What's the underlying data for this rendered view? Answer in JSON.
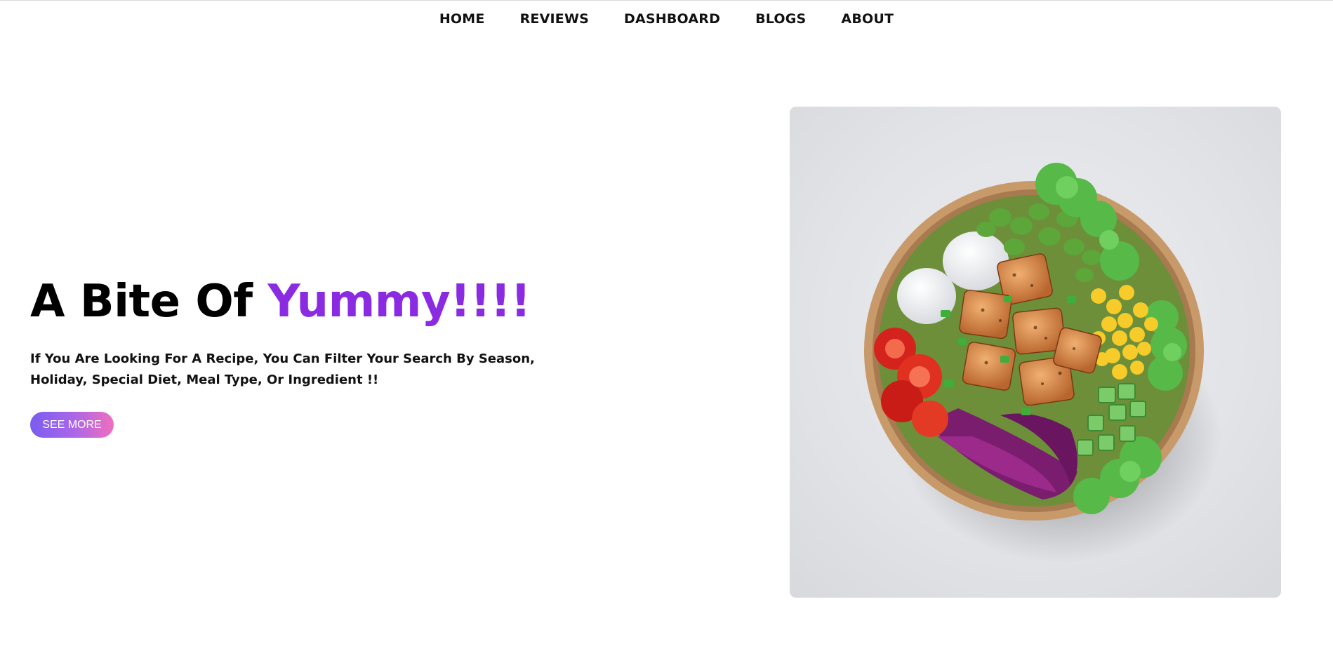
{
  "nav": {
    "items": [
      {
        "label": "HOME"
      },
      {
        "label": "REVIEWS"
      },
      {
        "label": "DASHBOARD"
      },
      {
        "label": "BLOGS"
      },
      {
        "label": "ABOUT"
      }
    ]
  },
  "hero": {
    "title_prefix": "A Bite Of ",
    "title_accent": "Yummy!!!!",
    "subtitle": "If You Are Looking For A Recipe, You Can Filter Your Search By Season, Holiday, Special Diet, Meal Type, Or Ingredient !!",
    "cta_label": "SEE MORE"
  },
  "colors": {
    "accent": "#8a2be2",
    "button_gradient_start": "#7b5cf0",
    "button_gradient_end": "#f06ec0"
  },
  "image": {
    "subject": "salad-bowl-photo"
  }
}
